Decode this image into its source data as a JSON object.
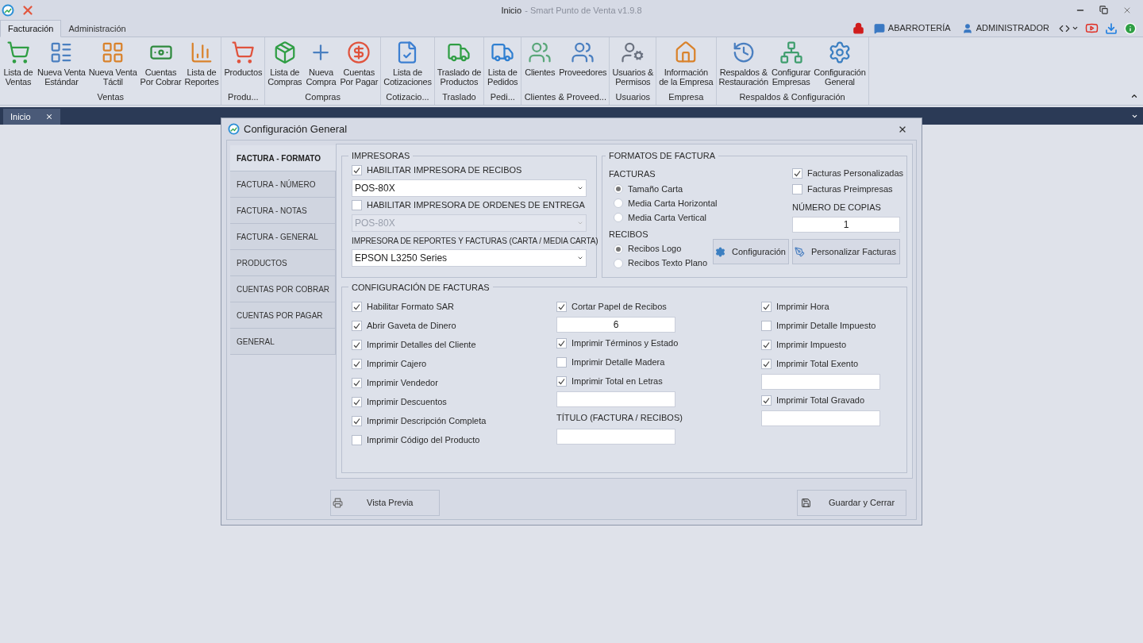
{
  "window": {
    "title": "Inicio",
    "subtitle": "- Smart Punto de Venta v1.9.8"
  },
  "ribbon_tabs": [
    {
      "label": "Facturación",
      "selected": true
    },
    {
      "label": "Administración",
      "selected": false
    }
  ],
  "status_items": [
    "ABARROTERÍA",
    "ADMINISTRADOR"
  ],
  "ribbon_groups": [
    {
      "label": "Ventas",
      "buttons": [
        [
          "Lista de",
          "Ventas"
        ],
        [
          "Nueva Venta",
          "Estándar"
        ],
        [
          "Nueva Venta",
          "Táctil"
        ],
        [
          "Cuentas",
          "Por Cobrar"
        ],
        [
          "Lista de",
          "Reportes"
        ]
      ]
    },
    {
      "label": "Produ...",
      "buttons": [
        [
          "Productos"
        ]
      ]
    },
    {
      "label": "Compras",
      "buttons": [
        [
          "Lista de",
          "Compras"
        ],
        [
          "Nueva",
          "Compra"
        ],
        [
          "Cuentas",
          "Por Pagar"
        ]
      ]
    },
    {
      "label": "Cotizacio...",
      "buttons": [
        [
          "Lista de",
          "Cotizaciones"
        ]
      ]
    },
    {
      "label": "Traslado",
      "buttons": [
        [
          "Traslado de",
          "Productos"
        ]
      ]
    },
    {
      "label": "Pedi...",
      "buttons": [
        [
          "Lista de",
          "Pedidos"
        ]
      ]
    },
    {
      "label": "Clientes & Proveed...",
      "buttons": [
        [
          "Clientes"
        ],
        [
          "Proveedores"
        ]
      ]
    },
    {
      "label": "Usuarios",
      "buttons": [
        [
          "Usuarios &",
          "Permisos"
        ]
      ]
    },
    {
      "label": "Empresa",
      "buttons": [
        [
          "Información",
          "de la Empresa"
        ]
      ]
    },
    {
      "label": "Respaldos & Configuración",
      "buttons": [
        [
          "Respaldos &",
          "Restauración"
        ],
        [
          "Configurar",
          "Empresas"
        ],
        [
          "Configuración",
          "General"
        ]
      ]
    }
  ],
  "document_tabs": [
    {
      "label": "Inicio",
      "selected": true
    }
  ],
  "dialog": {
    "title": "Configuración General",
    "nav": [
      {
        "label": "FACTURA - FORMATO",
        "selected": true
      },
      {
        "label": "FACTURA - NÚMERO",
        "selected": false
      },
      {
        "label": "FACTURA - NOTAS",
        "selected": false
      },
      {
        "label": "FACTURA - GENERAL",
        "selected": false
      },
      {
        "label": "PRODUCTOS",
        "selected": false
      },
      {
        "label": "CUENTAS POR COBRAR",
        "selected": false
      },
      {
        "label": "CUENTAS POR PAGAR",
        "selected": false
      },
      {
        "label": "GENERAL",
        "selected": false
      }
    ],
    "printers": {
      "title": "IMPRESORAS",
      "items": [
        {
          "kind": "checkbox",
          "label": "HABILITAR IMPRESORA DE RECIBOS",
          "checked": true
        },
        {
          "kind": "dropdown",
          "value": "POS-80X",
          "disabled": false
        },
        {
          "kind": "checkbox",
          "label": "HABILITAR IMPRESORA DE ORDENES DE ENTREGA",
          "checked": false
        },
        {
          "kind": "dropdown",
          "value": "POS-80X",
          "disabled": true
        },
        {
          "kind": "label",
          "label": "IMPRESORA DE REPORTES Y FACTURAS (CARTA / MEDIA CARTA)"
        },
        {
          "kind": "dropdown",
          "value": "EPSON L3250 Series",
          "disabled": false
        }
      ]
    },
    "formats": {
      "title": "FORMATOS DE FACTURA",
      "invoices_label": "FACTURAS",
      "invoice_options": [
        {
          "label": "Tamaño Carta",
          "selected": true
        },
        {
          "label": "Media Carta Horizontal",
          "selected": false
        },
        {
          "label": "Media Carta Vertical",
          "selected": false
        }
      ],
      "receipts_label": "RECIBOS",
      "receipt_options": [
        {
          "label": "Recibos Logo",
          "selected": true
        },
        {
          "label": "Recibos Texto Plano",
          "selected": false
        }
      ],
      "checks": [
        {
          "label": "Facturas Personalizadas",
          "checked": true
        },
        {
          "label": "Facturas Preimpresas",
          "checked": false
        }
      ],
      "copies_label": "NÚMERO DE COPIAS",
      "copies": "1",
      "buttons": [
        "Configuración",
        "Personalizar Facturas"
      ]
    },
    "invoice_config": {
      "title": "CONFIGURACIÓN DE FACTURAS",
      "columns": [
        [
          {
            "kind": "checkbox",
            "label": "Habilitar Formato SAR",
            "checked": true
          },
          {
            "kind": "checkbox",
            "label": "Abrir Gaveta de Dinero",
            "checked": true
          },
          {
            "kind": "checkbox",
            "label": "Imprimir Detalles del Cliente",
            "checked": true
          },
          {
            "kind": "checkbox",
            "label": "Imprimir Cajero",
            "checked": true
          },
          {
            "kind": "checkbox",
            "label": "Imprimir Vendedor",
            "checked": true
          },
          {
            "kind": "checkbox",
            "label": "Imprimir Descuentos",
            "checked": true
          },
          {
            "kind": "checkbox",
            "label": "Imprimir Descripción Completa",
            "checked": true
          },
          {
            "kind": "checkbox",
            "label": "Imprimir Código del Producto",
            "checked": false
          }
        ],
        [
          {
            "kind": "checkbox",
            "label": "Cortar Papel de Recibos",
            "checked": true
          },
          {
            "kind": "input",
            "value": "6"
          },
          {
            "kind": "checkbox",
            "label": "Imprimir Términos y Estado",
            "checked": true
          },
          {
            "kind": "checkbox",
            "label": "Imprimir Detalle Madera",
            "checked": false
          },
          {
            "kind": "checkbox",
            "label": "Imprimir Total en Letras",
            "checked": true
          },
          {
            "kind": "input"
          },
          {
            "kind": "label",
            "label": "TÍTULO (FACTURA / RECIBOS)"
          },
          {
            "kind": "input"
          }
        ],
        [
          {
            "kind": "checkbox",
            "label": "Imprimir Hora",
            "checked": true
          },
          {
            "kind": "checkbox",
            "label": "Imprimir Detalle Impuesto",
            "checked": false
          },
          {
            "kind": "checkbox",
            "label": "Imprimir Impuesto",
            "checked": true
          },
          {
            "kind": "checkbox",
            "label": "Imprimir Total Exento",
            "checked": true
          },
          {
            "kind": "input"
          },
          {
            "kind": "checkbox",
            "label": "Imprimir Total Gravado",
            "checked": true
          },
          {
            "kind": "input"
          }
        ]
      ]
    },
    "buttons": [
      "Vista Previa",
      "Guardar y Cerrar"
    ]
  }
}
